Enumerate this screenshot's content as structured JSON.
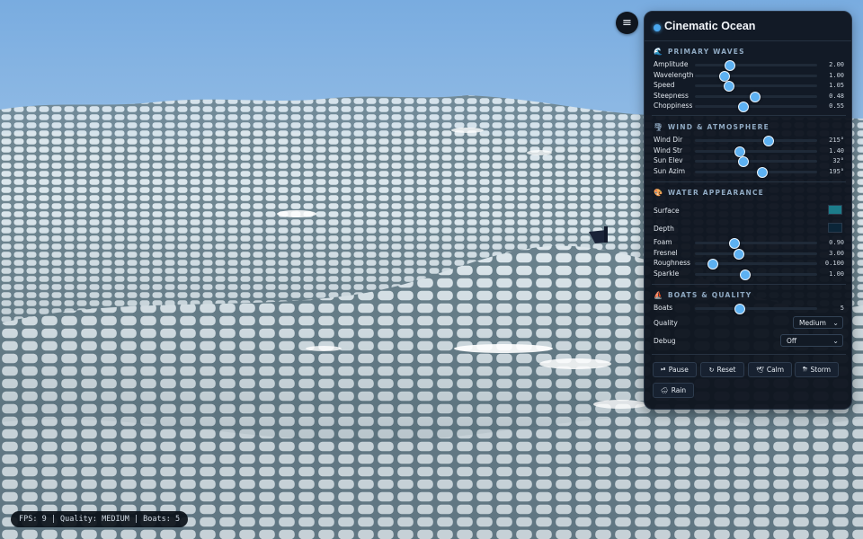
{
  "menu": {
    "icon": "hamburger-menu-icon",
    "glyph": "≡"
  },
  "panel": {
    "title": "Cinematic Ocean",
    "sections": {
      "primary": {
        "title": "PRIMARY WAVES",
        "icon": "wave-icon",
        "glyph": "🌊",
        "sliders": [
          {
            "key": "amplitude",
            "label": "Amplitude",
            "value": "2.00",
            "pos": 0.29
          },
          {
            "key": "wavelength",
            "label": "Wavelength",
            "value": "1.00",
            "pos": 0.24
          },
          {
            "key": "speed",
            "label": "Speed",
            "value": "1.05",
            "pos": 0.28
          },
          {
            "key": "steepness",
            "label": "Steepness",
            "value": "0.48",
            "pos": 0.49
          },
          {
            "key": "choppiness",
            "label": "Choppiness",
            "value": "0.55",
            "pos": 0.4
          }
        ]
      },
      "wind": {
        "title": "WIND & ATMOSPHERE",
        "icon": "wind-icon",
        "glyph": "🌪",
        "sliders": [
          {
            "key": "wind-dir",
            "label": "Wind Dir",
            "value": "215°",
            "pos": 0.6
          },
          {
            "key": "wind-str",
            "label": "Wind Str",
            "value": "1.40",
            "pos": 0.37
          },
          {
            "key": "sun-elev",
            "label": "Sun Elev",
            "value": "32°",
            "pos": 0.4
          },
          {
            "key": "sun-azim",
            "label": "Sun Azim",
            "value": "195°",
            "pos": 0.55
          }
        ]
      },
      "water": {
        "title": "WATER APPEARANCE",
        "icon": "palette-icon",
        "glyph": "🎨",
        "colors": [
          {
            "key": "surface",
            "label": "Surface",
            "color": "#1c7c8a"
          },
          {
            "key": "depth",
            "label": "Depth",
            "color": "#0b2538"
          }
        ],
        "sliders": [
          {
            "key": "foam",
            "label": "Foam",
            "value": "0.90",
            "pos": 0.32
          },
          {
            "key": "fresnel",
            "label": "Fresnel",
            "value": "3.00",
            "pos": 0.36
          },
          {
            "key": "roughness",
            "label": "Roughness",
            "value": "0.100",
            "pos": 0.15
          },
          {
            "key": "sparkle",
            "label": "Sparkle",
            "value": "1.00",
            "pos": 0.41
          }
        ]
      },
      "boats": {
        "title": "BOATS & QUALITY",
        "icon": "sailboat-icon",
        "glyph": "⛵",
        "sliders": [
          {
            "key": "boats",
            "label": "Boats",
            "value": "5",
            "pos": 0.37
          }
        ],
        "quality": {
          "label": "Quality",
          "value": "Medium"
        },
        "debug": {
          "label": "Debug",
          "value": "Off"
        }
      }
    },
    "buttons": [
      {
        "key": "pause",
        "label": "Pause",
        "icon": "pause-icon",
        "glyph": "⏯"
      },
      {
        "key": "reset",
        "label": "Reset",
        "icon": "reset-icon",
        "glyph": "↻"
      },
      {
        "key": "calm",
        "label": "Calm",
        "icon": "dove-icon",
        "glyph": "🕊"
      },
      {
        "key": "storm",
        "label": "Storm",
        "icon": "storm-icon",
        "glyph": "⛈"
      },
      {
        "key": "rain",
        "label": "Rain",
        "icon": "rain-icon",
        "glyph": "🌧"
      }
    ]
  },
  "status": {
    "text": "FPS: 9 | Quality: MEDIUM | Boats: 5"
  },
  "colors": {
    "accent": "#5db1f2",
    "panel_bg": "#0e141e",
    "sky_top": "#7fb0e2",
    "sky_bottom": "#d8e7f2"
  }
}
